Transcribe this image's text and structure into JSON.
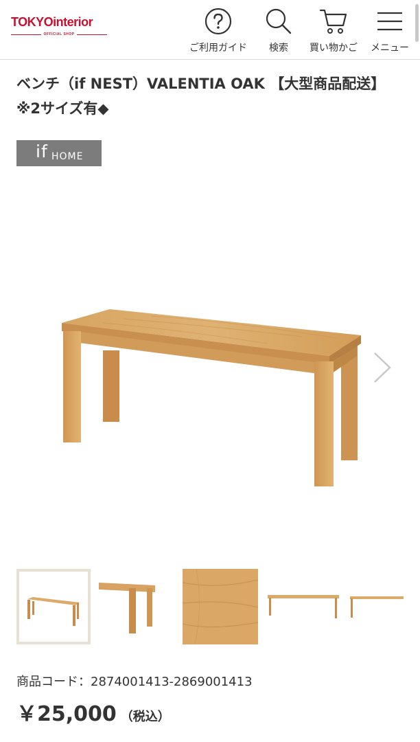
{
  "header": {
    "logo_main": "TOKYOinterior",
    "logo_sub": "OFFICIAL SHOP",
    "nav": [
      {
        "label": "ご利用ガイド",
        "icon": "question-circle-icon"
      },
      {
        "label": "検索",
        "icon": "search-icon"
      },
      {
        "label": "買い物かご",
        "icon": "cart-icon"
      },
      {
        "label": "メニュー",
        "icon": "hamburger-menu-icon"
      }
    ]
  },
  "product": {
    "title": "ベンチ（if NEST）VALENTIA OAK 【大型商品配送】※2サイズ有◆",
    "brand": {
      "logo_if": "if",
      "logo_home": "HOME"
    },
    "code_label": "商品コード：",
    "code_value": "2874001413-2869001413",
    "price": "￥25,000",
    "tax_note": "（税込）"
  },
  "colors": {
    "brand_red": "#c8102e",
    "badge_gray": "#7c7c7c",
    "oak": "#d9a866"
  },
  "gallery": {
    "thumbnails": [
      "bench-front",
      "bench-side-closeup",
      "oak-grain",
      "bench-long",
      "bench-edge"
    ],
    "selected_index": 0
  }
}
